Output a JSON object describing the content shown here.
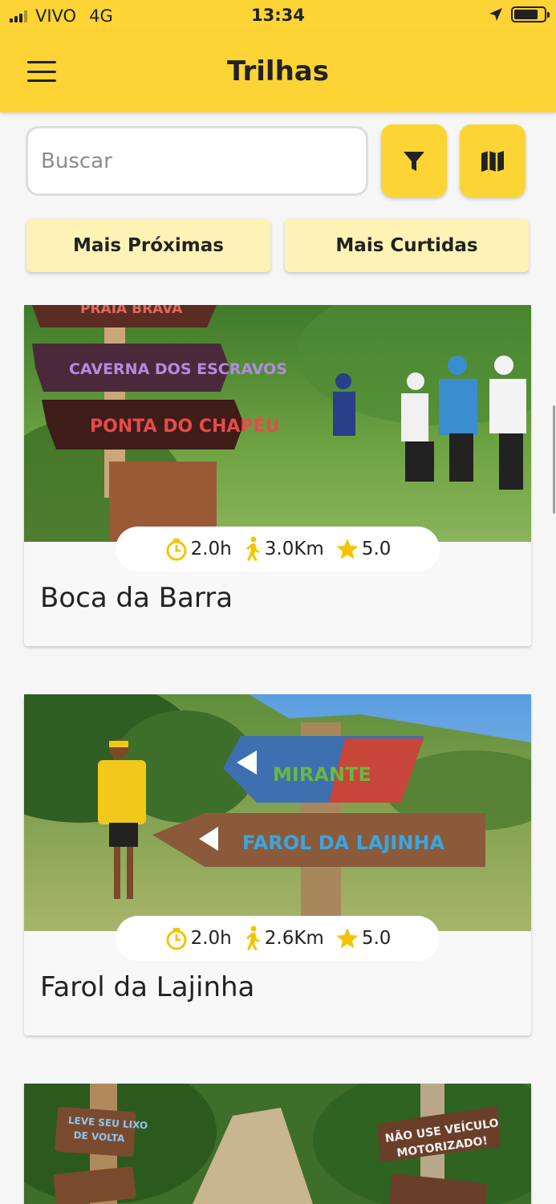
{
  "status_bar": {
    "carrier": "VIVO",
    "network": "4G",
    "time": "13:34"
  },
  "header": {
    "title": "Trilhas"
  },
  "search": {
    "placeholder": "Buscar"
  },
  "sort_buttons": [
    "Mais Próximas",
    "Mais Curtidas"
  ],
  "icons": {
    "menu": "menu-icon",
    "filter": "filter-icon",
    "map": "map-icon",
    "duration": "timer-icon",
    "distance": "hiker-icon",
    "rating": "star-icon"
  },
  "colors": {
    "brand": "#fdd435",
    "pill": "#fdf3b4",
    "star": "#f5c400"
  },
  "trails": [
    {
      "name": "Boca da Barra",
      "duration": "2.0h",
      "distance": "3.0Km",
      "rating": "5.0",
      "photo_signs": [
        "PRAIA BRAVA",
        "CAVERNA DOS ESCRAVOS",
        "PONTA DO CHAPÉU"
      ]
    },
    {
      "name": "Farol da Lajinha",
      "duration": "2.0h",
      "distance": "2.6Km",
      "rating": "5.0",
      "photo_signs": [
        "MIRANTE",
        "FAROL DA LAJINHA"
      ]
    },
    {
      "name": "",
      "photo_signs": [
        "LEVE SEU LIXO DE VOLTA",
        "NÃO USE VEÍCULO MOTORIZADO!"
      ]
    }
  ]
}
